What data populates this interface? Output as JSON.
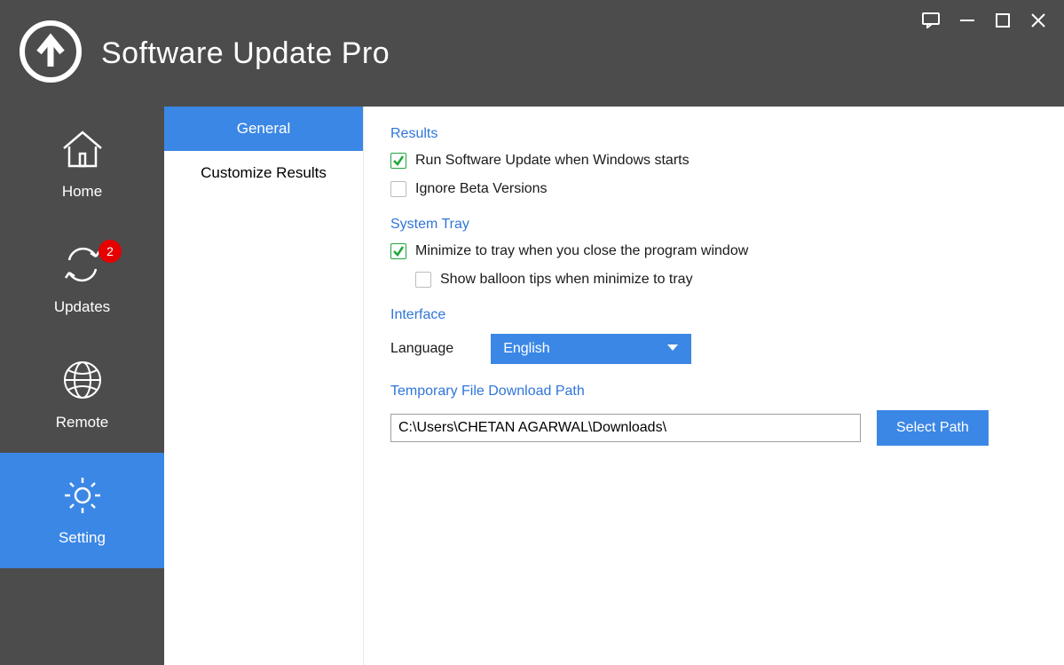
{
  "app": {
    "title": "Software Update Pro"
  },
  "sidebar": {
    "home": {
      "label": "Home"
    },
    "updates": {
      "label": "Updates",
      "badge": "2"
    },
    "remote": {
      "label": "Remote"
    },
    "setting": {
      "label": "Setting"
    }
  },
  "subnav": {
    "general": "General",
    "customize": "Customize Results"
  },
  "settings": {
    "results": {
      "header": "Results",
      "runOnStart": {
        "label": "Run Software Update when Windows starts",
        "checked": true
      },
      "ignoreBeta": {
        "label": "Ignore Beta Versions",
        "checked": false
      }
    },
    "tray": {
      "header": "System Tray",
      "minimizeToTray": {
        "label": "Minimize to tray when you close the program window",
        "checked": true
      },
      "balloonTips": {
        "label": "Show balloon tips when minimize to tray",
        "checked": false
      }
    },
    "interface": {
      "header": "Interface",
      "languageLabel": "Language",
      "languageValue": "English"
    },
    "downloadPath": {
      "header": "Temporary File Download Path",
      "value": "C:\\Users\\CHETAN AGARWAL\\Downloads\\",
      "selectButton": "Select Path"
    }
  }
}
